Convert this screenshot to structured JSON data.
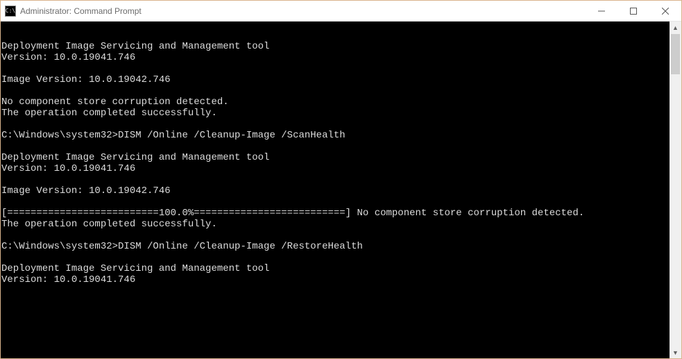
{
  "window": {
    "title": "Administrator: Command Prompt",
    "icon_label": "C:\\"
  },
  "console": {
    "lines": [
      "",
      "Deployment Image Servicing and Management tool",
      "Version: 10.0.19041.746",
      "",
      "Image Version: 10.0.19042.746",
      "",
      "No component store corruption detected.",
      "The operation completed successfully.",
      "",
      "C:\\Windows\\system32>DISM /Online /Cleanup-Image /ScanHealth",
      "",
      "Deployment Image Servicing and Management tool",
      "Version: 10.0.19041.746",
      "",
      "Image Version: 10.0.19042.746",
      "",
      "[==========================100.0%==========================] No component store corruption detected.",
      "The operation completed successfully.",
      "",
      "C:\\Windows\\system32>DISM /Online /Cleanup-Image /RestoreHealth",
      "",
      "Deployment Image Servicing and Management tool",
      "Version: 10.0.19041.746"
    ]
  }
}
